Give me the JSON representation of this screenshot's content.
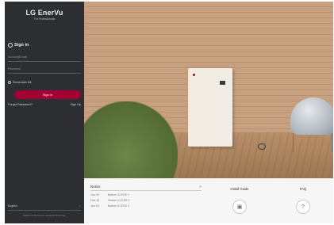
{
  "brand": {
    "title": "LG EnerVu",
    "subtitle": "For Professionals"
  },
  "signin": {
    "heading": "Sign in",
    "email_placeholder": "Account(Email)",
    "password_placeholder": "Password",
    "remember_label": "Remember Me",
    "signin_button": "Sign in",
    "forgot_password": "Forgot Password?",
    "sign_up": "Sign Up"
  },
  "footer": {
    "language": "English",
    "copyright": "©2023 LG Electronics. All Rights Reserved."
  },
  "notice": {
    "title": "Notice",
    "items": [
      {
        "date": "Jun 04",
        "text": "Notice LG ESS 1"
      },
      {
        "date": "Feb 15",
        "text": "Notice LG ESS 2"
      },
      {
        "date": "Jan 24",
        "text": "Notice LG ESS 3"
      }
    ]
  },
  "cards": {
    "install_guide": "Install Guide",
    "faq": "FAQ"
  },
  "colors": {
    "sidebar_bg": "#2d2e32",
    "accent": "#a50034"
  }
}
